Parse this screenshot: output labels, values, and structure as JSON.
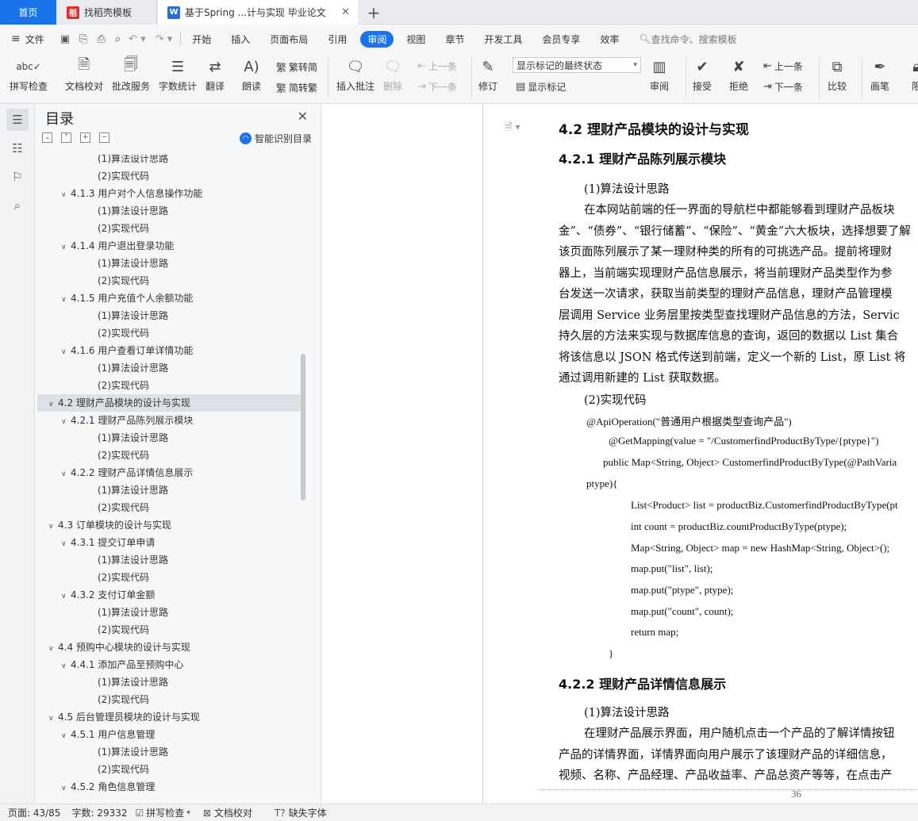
{
  "tabs": [
    {
      "label": "首页"
    },
    {
      "label": "找稻壳模板"
    },
    {
      "label": "基于Spring ...计与实现 毕业论文"
    }
  ],
  "menu": {
    "file": "文件",
    "items": [
      "开始",
      "插入",
      "页面布局",
      "引用",
      "审阅",
      "视图",
      "章节",
      "开发工具",
      "会员专享",
      "效率"
    ],
    "active": "审阅",
    "search_placeholder": "查找命令、搜索模板"
  },
  "ribbon": {
    "spell": "拼写检查",
    "proof": "文档校对",
    "batch": "批改服务",
    "wordcount": "字数统计",
    "translate": "翻译",
    "read": "朗读",
    "trad": "繁转简",
    "simp": "简转繁",
    "insert_comment": "插入批注",
    "delete": "删除",
    "prev": "上一条",
    "next": "下一条",
    "revise": "修订",
    "markup_select": "显示标记的最终状态",
    "show_markup": "显示标记",
    "review": "审阅",
    "accept": "接受",
    "reject": "拒绝",
    "prev2": "上一条",
    "next2": "下一条",
    "compare": "比较",
    "pen": "画笔",
    "restrict": "限"
  },
  "toc": {
    "title": "目录",
    "smart": "智能识别目录",
    "items": [
      {
        "text": "(1)算法设计思路",
        "level": 3
      },
      {
        "text": "(2)实现代码",
        "level": 3
      },
      {
        "text": "4.1.3  用户对个人信息操作功能",
        "level": 2
      },
      {
        "text": "(1)算法设计思路",
        "level": 3
      },
      {
        "text": "(2)实现代码",
        "level": 3
      },
      {
        "text": "4.1.4  用户退出登录功能",
        "level": 2
      },
      {
        "text": "(1)算法设计思路",
        "level": 3
      },
      {
        "text": "(2)实现代码",
        "level": 3
      },
      {
        "text": "4.1.5  用户充值个人余额功能",
        "level": 2
      },
      {
        "text": "(1)算法设计思路",
        "level": 3
      },
      {
        "text": "(2)实现代码",
        "level": 3
      },
      {
        "text": "4.1.6  用户查看订单详情功能",
        "level": 2
      },
      {
        "text": "(1)算法设计思路",
        "level": 3
      },
      {
        "text": "(2)实现代码",
        "level": 3
      },
      {
        "text": "4.2 理财产品模块的设计与实现",
        "level": 1,
        "selected": true
      },
      {
        "text": "4.2.1  理财产品陈列展示模块",
        "level": 2
      },
      {
        "text": "(1)算法设计思路",
        "level": 3
      },
      {
        "text": "(2)实现代码",
        "level": 3
      },
      {
        "text": "4.2.2  理财产品详情信息展示",
        "level": 2
      },
      {
        "text": "(1)算法设计思路",
        "level": 3
      },
      {
        "text": "(2)实现代码",
        "level": 3
      },
      {
        "text": "4.3  订单模块的设计与实现",
        "level": 1
      },
      {
        "text": "4.3.1 提交订单申请",
        "level": 2
      },
      {
        "text": "(1)算法设计思路",
        "level": 3
      },
      {
        "text": "(2)实现代码",
        "level": 3
      },
      {
        "text": "4.3.2 支付订单金额",
        "level": 2
      },
      {
        "text": "(1)算法设计思路",
        "level": 3
      },
      {
        "text": "(2)实现代码",
        "level": 3
      },
      {
        "text": "4.4  预购中心模块的设计与实现",
        "level": 1
      },
      {
        "text": "4.4.1  添加产品至预购中心",
        "level": 2
      },
      {
        "text": "(1)算法设计思路",
        "level": 3
      },
      {
        "text": "(2)实现代码",
        "level": 3
      },
      {
        "text": "4.5  后台管理员模块的设计与实现",
        "level": 1
      },
      {
        "text": "4.5.1  用户信息管理",
        "level": 2
      },
      {
        "text": "(1)算法设计思路",
        "level": 3
      },
      {
        "text": "(2)实现代码",
        "level": 3
      },
      {
        "text": "4.5.2  角色信息管理",
        "level": 2
      }
    ]
  },
  "document": {
    "h2": "4.2 理财产品模块的设计与实现",
    "h3a": "4.2.1  理财产品陈列展示模块",
    "s1": "(1)算法设计思路",
    "p1": [
      "在本网站前端的任一界面的导航栏中都能够看到理财产品板块",
      "金”、“债券”、“银行储蓄”、“保险”、“黄金”六大板块，选择想要了解",
      "该页面陈列展示了某一理财种类的所有的可挑选产品。提前将理财",
      "器上，当前端实现理财产品信息展示，将当前理财产品类型作为参",
      "台发送一次请求，获取当前类型的理财产品信息，理财产品管理模",
      "层调用 Service 业务层里按类型查找理财产品信息的方法，Servic",
      "持久层的方法来实现与数据库信息的查询，返回的数据以 List 集合",
      "将该信息以 JSON 格式传送到前端，定义一个新的 List，原 List 将",
      "通过调用新建的 List 获取数据。"
    ],
    "s2": "(2)实现代码",
    "code": [
      "@ApiOperation(\"普通用户根据类型查询产品\")",
      "@GetMapping(value = \"/CustomerfindProductByType/{ptype}\")",
      "public Map<String, Object> CustomerfindProductByType(@PathVaria",
      "ptype){",
      "List<Product> list = productBiz.CustomerfindProductByType(pt",
      "int count = productBiz.countProductByType(ptype);",
      "Map<String, Object> map = new HashMap<String, Object>();",
      "map.put(\"list\", list);",
      "map.put(\"ptype\", ptype);",
      "map.put(\"count\", count);",
      "return map;",
      "}"
    ],
    "h3b": "4.2.2  理财产品详情信息展示",
    "s3": "(1)算法设计思路",
    "p2": [
      "在理财产品展示界面，用户随机点击一个产品的了解详情按钮",
      "产品的详情界面，详情界面向用户展示了该理财产品的详细信息，",
      "视频、名称、产品经理、产品收益率、产品总资产等等，在点击产"
    ],
    "page_number": "36"
  },
  "status": {
    "page": "页面: 43/85",
    "words": "字数: 29332",
    "spell": "拼写检查",
    "proof": "文档校对",
    "font": "缺失字体"
  },
  "colors": {
    "accent": "#1a73e8",
    "wps_red": "#d9312e",
    "wps_blue": "#2b6fd6"
  }
}
